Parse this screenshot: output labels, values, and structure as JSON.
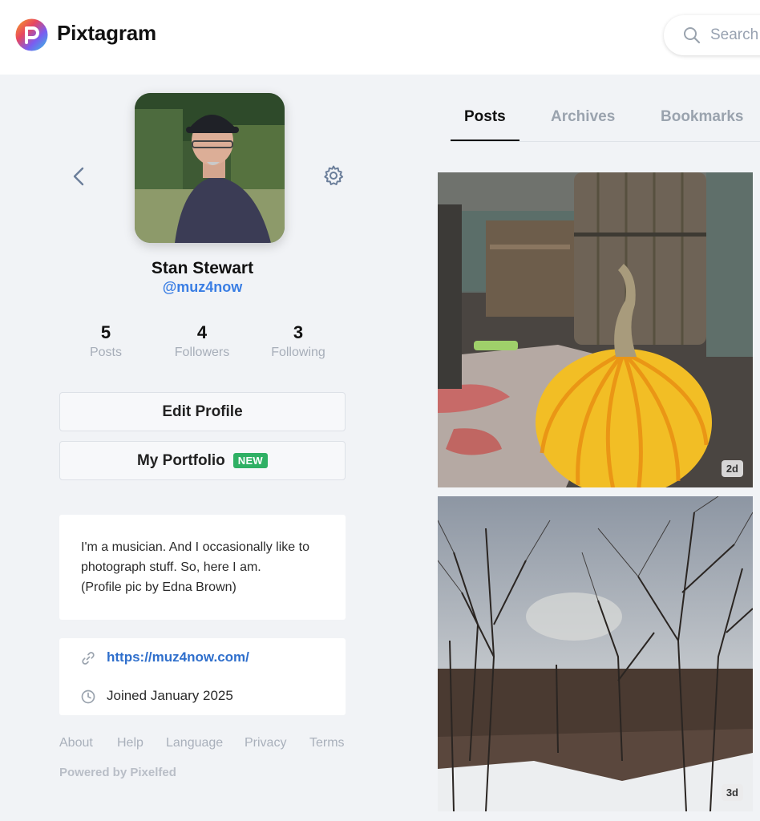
{
  "app": {
    "name": "Pixtagram",
    "logo_icon": "pixtagram-logo-icon"
  },
  "search": {
    "placeholder": "Search",
    "icon": "search-icon"
  },
  "profile": {
    "display_name": "Stan Stewart",
    "username": "@muz4now",
    "stats": [
      {
        "value": "5",
        "label": "Posts"
      },
      {
        "value": "4",
        "label": "Followers"
      },
      {
        "value": "3",
        "label": "Following"
      }
    ],
    "edit_label": "Edit Profile",
    "portfolio_label": "My Portfolio",
    "portfolio_badge": "NEW",
    "bio_lines": [
      "I'm a musician. And I occasionally like to",
      "photograph stuff. So, here I am.",
      "(Profile pic by Edna Brown)"
    ],
    "website": "https://muz4now.com/",
    "joined": "Joined January 2025"
  },
  "footer": {
    "links": [
      "About",
      "Help",
      "Language",
      "Privacy",
      "Terms"
    ],
    "powered_by": "Powered by Pixelfed"
  },
  "tabs": [
    {
      "label": "Posts",
      "active": true
    },
    {
      "label": "Archives",
      "active": false
    },
    {
      "label": "Bookmarks",
      "active": false
    }
  ],
  "posts": [
    {
      "age": "2d",
      "subject": "pumpkin-photo"
    },
    {
      "age": "3d",
      "subject": "winter-trees-photo"
    }
  ],
  "colors": {
    "accent": "#3a7ee4",
    "link": "#2f6fcc",
    "badge_green": "#2fb064",
    "page_bg": "#f1f3f6"
  }
}
